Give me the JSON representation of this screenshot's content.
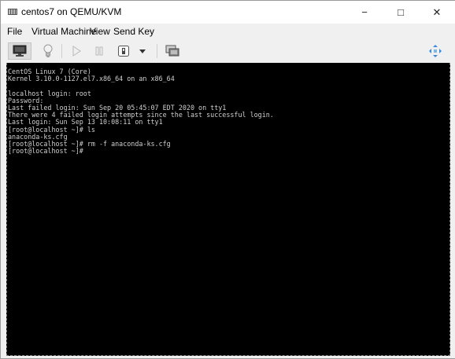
{
  "window": {
    "title": "centos7 on QEMU/KVM",
    "controls": {
      "minimize": "−",
      "maximize": "□",
      "close": "✕"
    }
  },
  "menu": {
    "items": [
      "File",
      "Virtual Machine",
      "View",
      "Send Key"
    ]
  },
  "toolbar": {
    "icons": [
      "monitor-icon",
      "lightbulb-icon",
      "play-icon",
      "pause-icon",
      "power-icon",
      "dropdown-arrow-icon",
      "snapshot-icon",
      "resize-icon"
    ]
  },
  "console": {
    "lines": [
      "CentOS Linux 7 (Core)",
      "Kernel 3.10.0-1127.el7.x86_64 on an x86_64",
      "",
      "localhost login: root",
      "Password:",
      "Last failed login: Sun Sep 20 05:45:07 EDT 2020 on tty1",
      "There were 4 failed login attempts since the last successful login.",
      "Last login: Sun Sep 13 10:08:11 on tty1",
      "[root@localhost ~]# ls",
      "anaconda-ks.cfg",
      "[root@localhost ~]# rm -f anaconda-ks.cfg",
      "[root@localhost ~]#"
    ]
  },
  "colors": {
    "console_bg": "#000000",
    "console_fg": "#d0d0d0",
    "chrome": "#f0f0f0",
    "titlebar": "#ffffff"
  }
}
